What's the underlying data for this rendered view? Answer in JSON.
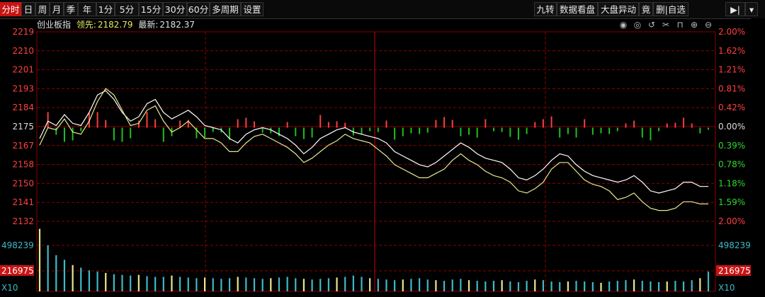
{
  "toolbar": {
    "left_tabs": [
      "分时",
      "日",
      "周",
      "月",
      "季",
      "年",
      "1分",
      "5分",
      "15分",
      "30分",
      "60分",
      "多周期",
      "设置"
    ],
    "active_tab": "分时",
    "right_tabs": [
      "九转",
      "数据看盘",
      "大盘异动",
      "竟",
      "删|自选"
    ]
  },
  "info": {
    "title": "创业板指",
    "lead_label": "领先:",
    "lead_value": "2182.79",
    "latest_label": "最新:",
    "latest_value": "2182.37"
  },
  "icons": [
    "eye-icon",
    "eye-off-icon",
    "undo-icon",
    "scissors-icon",
    "lock-icon",
    "zoom-in-icon",
    "zoom-out-icon"
  ],
  "colors": {
    "up": "#ff3c3c",
    "down": "#1fbf1f",
    "white_line": "#ffffff",
    "yellow_line": "#e8e890",
    "grid": "#8b0000",
    "volume": "#3fb9c8"
  },
  "chart_data": {
    "type": "line",
    "price_ticks": [
      "2219",
      "2210",
      "2201",
      "2193",
      "2184",
      "2175",
      "2167",
      "2158",
      "2150",
      "2141",
      "2132"
    ],
    "pct_ticks": [
      "2.00%",
      "1.62%",
      "1.21%",
      "0.81%",
      "0.42%",
      "0.00%",
      "0.39%",
      "0.78%",
      "1.18%",
      "1.59%",
      "2.00%"
    ],
    "base": 2175,
    "ylim": [
      2132,
      2219
    ],
    "series": [
      {
        "values": [
          2170,
          2178,
          2176,
          2181,
          2177,
          2176,
          2182,
          2190,
          2192,
          2188,
          2182,
          2178,
          2180,
          2186,
          2188,
          2182,
          2179,
          2181,
          2183,
          2180,
          2176,
          2175,
          2174,
          2170,
          2168,
          2172,
          2174,
          2175,
          2174,
          2172,
          2170,
          2167,
          2163,
          2166,
          2170,
          2172,
          2174,
          2175,
          2173,
          2172,
          2171,
          2170,
          2168,
          2164,
          2162,
          2160,
          2158,
          2157,
          2159,
          2162,
          2165,
          2168,
          2166,
          2163,
          2161,
          2160,
          2159,
          2156,
          2152,
          2151,
          2153,
          2156,
          2160,
          2163,
          2162,
          2158,
          2155,
          2153,
          2152,
          2151,
          2150,
          2151,
          2153,
          2150,
          2146,
          2145,
          2146,
          2147,
          2150,
          2150,
          2148,
          2148
        ]
      },
      {
        "values": [
          2167,
          2175,
          2174,
          2179,
          2173,
          2172,
          2178,
          2187,
          2193,
          2190,
          2183,
          2176,
          2177,
          2183,
          2185,
          2178,
          2173,
          2175,
          2178,
          2174,
          2170,
          2170,
          2168,
          2164,
          2164,
          2168,
          2171,
          2172,
          2170,
          2168,
          2166,
          2163,
          2159,
          2161,
          2164,
          2167,
          2169,
          2172,
          2170,
          2169,
          2168,
          2165,
          2162,
          2158,
          2156,
          2154,
          2152,
          2152,
          2154,
          2156,
          2160,
          2163,
          2160,
          2158,
          2155,
          2153,
          2152,
          2150,
          2146,
          2145,
          2147,
          2150,
          2156,
          2159,
          2159,
          2155,
          2151,
          2149,
          2148,
          2146,
          2142,
          2143,
          2145,
          2141,
          2138,
          2137,
          2137,
          2138,
          2141,
          2141,
          2140,
          2140
        ]
      }
    ],
    "volume_ticks": [
      "498239",
      "216975",
      "X10"
    ],
    "volume_values": [
      95,
      70,
      55,
      48,
      40,
      36,
      32,
      30,
      28,
      26,
      25,
      24,
      25,
      23,
      22,
      22,
      24,
      22,
      21,
      20,
      21,
      20,
      19,
      20,
      22,
      21,
      20,
      19,
      20,
      21,
      22,
      20,
      19,
      18,
      19,
      20,
      21,
      22,
      24,
      22,
      20,
      19,
      18,
      17,
      18,
      19,
      20,
      18,
      17,
      16,
      18,
      19,
      17,
      16,
      15,
      16,
      17,
      15,
      14,
      16,
      18,
      17,
      15,
      14,
      15,
      16,
      15,
      14,
      13,
      15,
      16,
      17,
      18,
      16,
      15,
      14,
      15,
      16,
      15,
      17,
      20,
      30
    ],
    "volume_ylim": [
      0,
      100
    ]
  }
}
